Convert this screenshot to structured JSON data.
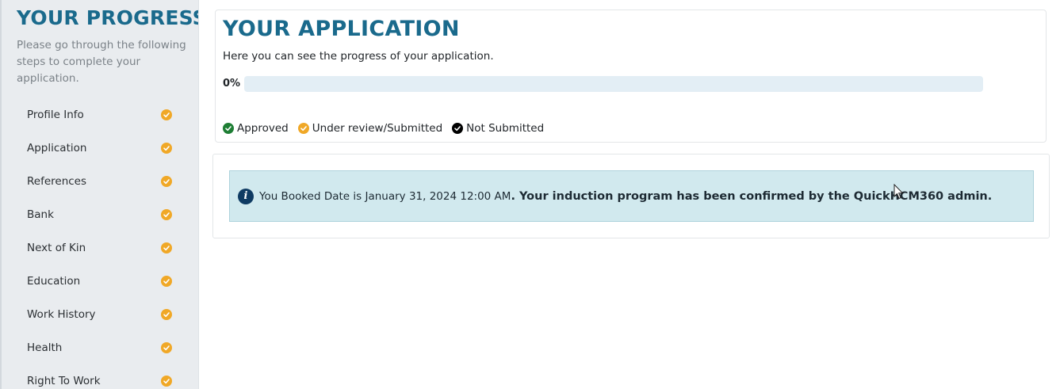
{
  "sidebar": {
    "title": "YOUR PROGRESS",
    "description": "Please go through the following steps to complete your application.",
    "items": [
      {
        "label": "Profile Info",
        "status": "under-review"
      },
      {
        "label": "Application",
        "status": "under-review"
      },
      {
        "label": "References",
        "status": "under-review"
      },
      {
        "label": "Bank",
        "status": "under-review"
      },
      {
        "label": "Next of Kin",
        "status": "under-review"
      },
      {
        "label": "Education",
        "status": "under-review"
      },
      {
        "label": "Work History",
        "status": "under-review"
      },
      {
        "label": "Health",
        "status": "under-review"
      },
      {
        "label": "Right To Work",
        "status": "under-review"
      }
    ]
  },
  "application": {
    "title": "YOUR APPLICATION",
    "subtitle": "Here you can see the progress of your application.",
    "progress_label": "0%",
    "progress_percent": 0
  },
  "legend": {
    "approved": "Approved",
    "under_review": "Under review/Submitted",
    "not_submitted": "Not Submitted"
  },
  "notice": {
    "icon": "info-icon",
    "booked_text": "You Booked Date is January 31, 2024 12:00 AM",
    "confirmed_text": ". Your induction program has been confirmed by the QuickHCM360 admin."
  },
  "colors": {
    "brand": "#1a6a8c",
    "approved": "#1e7e34",
    "under_review": "#f0a827",
    "not_submitted": "#000000",
    "alert_bg": "#d1e9ee"
  }
}
